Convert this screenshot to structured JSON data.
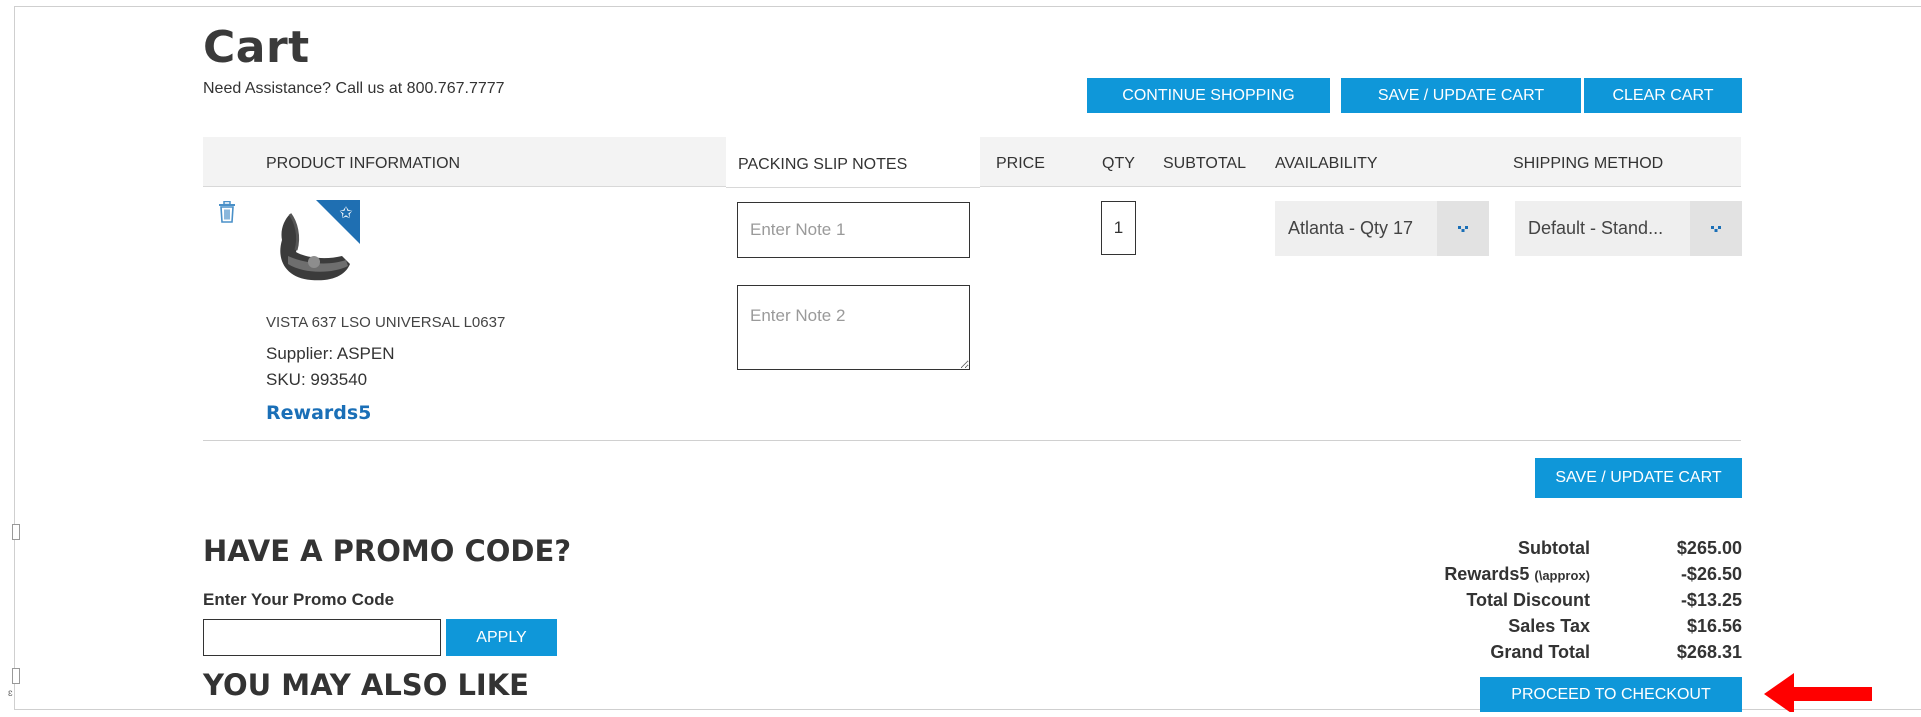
{
  "page": {
    "title": "Cart",
    "assistance": "Need Assistance? Call us at 800.767.7777",
    "edge_text": "ɛ"
  },
  "top_actions": {
    "continue_shopping": "CONTINUE SHOPPING",
    "save_update_cart": "SAVE / UPDATE CART",
    "clear_cart": "CLEAR CART"
  },
  "table": {
    "headers": {
      "product_information": "PRODUCT INFORMATION",
      "packing_slip_notes": "PACKING SLIP NOTES",
      "price": "PRICE",
      "qty": "QTY",
      "subtotal": "SUBTOTAL",
      "availability": "AVAILABILITY",
      "shipping_method": "SHIPPING METHOD"
    },
    "rows": [
      {
        "name": "VISTA 637 LSO UNIVERSAL L0637",
        "supplier": "Supplier: ASPEN",
        "sku": "SKU: 993540",
        "rewards": "Rewards5",
        "note1_placeholder": "Enter Note 1",
        "note2_placeholder": "Enter Note 2",
        "qty": "1",
        "availability": "Atlanta - Qty 17",
        "shipping": "Default - Stand..."
      }
    ]
  },
  "below_table": {
    "save_update_cart": "SAVE / UPDATE CART"
  },
  "promo": {
    "heading": "HAVE A PROMO CODE?",
    "label": "Enter Your Promo Code",
    "apply": "APPLY"
  },
  "recommendations": {
    "heading": "YOU MAY ALSO LIKE"
  },
  "totals": {
    "subtotal_label": "Subtotal",
    "subtotal": "$265.00",
    "rewards_label": "Rewards5",
    "rewards_note": "(\\approx)",
    "rewards": "-$26.50",
    "discount_label": "Total Discount",
    "discount": "-$13.25",
    "tax_label": "Sales Tax",
    "tax": "$16.56",
    "grand_label": "Grand Total",
    "grand": "$268.31",
    "checkout": "PROCEED TO CHECKOUT"
  },
  "colors": {
    "button_blue": "#0f97d9",
    "rewards_blue": "#1a6fb7",
    "annotation_arrow": "#ff0000"
  },
  "icons": [
    "trash-icon",
    "star-badge-icon",
    "chevron-down-icon",
    "red-arrow-annotation"
  ]
}
